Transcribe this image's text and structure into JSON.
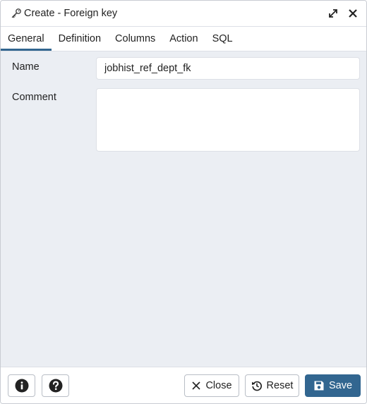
{
  "dialog": {
    "title": "Create - Foreign key",
    "title_icon": "key-icon",
    "maximize_icon": "expand-arrows-icon",
    "close_icon": "close-x-icon"
  },
  "tabs": [
    {
      "label": "General",
      "active": true
    },
    {
      "label": "Definition",
      "active": false
    },
    {
      "label": "Columns",
      "active": false
    },
    {
      "label": "Action",
      "active": false
    },
    {
      "label": "SQL",
      "active": false
    }
  ],
  "form": {
    "name_label": "Name",
    "name_value": "jobhist_ref_dept_fk",
    "comment_label": "Comment",
    "comment_value": ""
  },
  "footer": {
    "info_icon": "info-circle-icon",
    "help_icon": "question-circle-icon",
    "close_label": "Close",
    "reset_label": "Reset",
    "save_label": "Save"
  },
  "colors": {
    "accent": "#326690",
    "panel_background": "#ebeef3",
    "border": "#dde0e6"
  }
}
